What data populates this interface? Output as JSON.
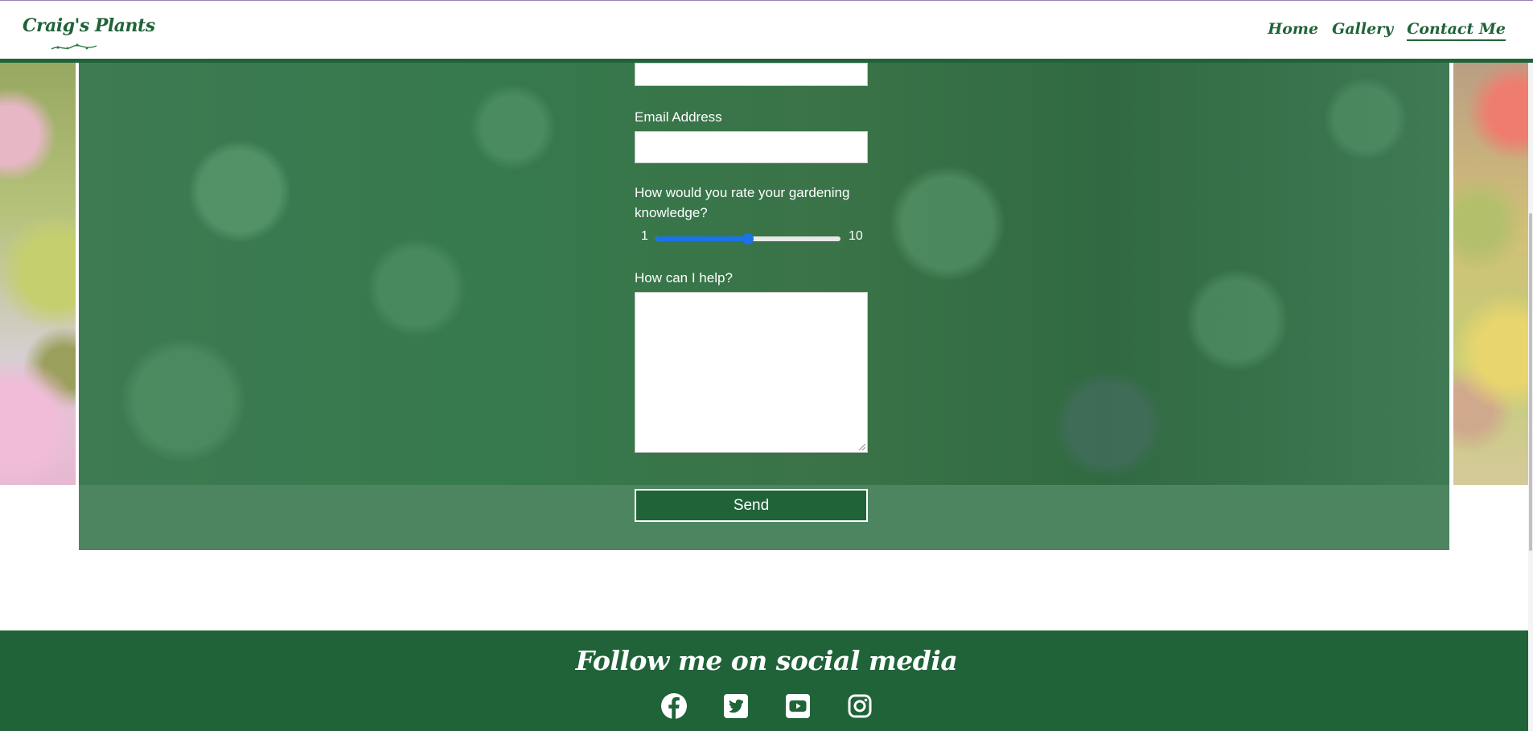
{
  "brand": {
    "name": "Craig's Plants"
  },
  "nav": {
    "items": [
      {
        "label": "Home",
        "active": false
      },
      {
        "label": "Gallery",
        "active": false
      },
      {
        "label": "Contact Me",
        "active": true
      }
    ]
  },
  "form": {
    "name_value": "",
    "email": {
      "label": "Email Address",
      "value": ""
    },
    "rating": {
      "label": "How would you rate your gardening knowledge?",
      "min": "1",
      "max": "10",
      "value": 5.5
    },
    "help": {
      "label": "How can I help?",
      "value": ""
    },
    "send_label": "Send"
  },
  "footer": {
    "title": "Follow me on social media",
    "icons": [
      "facebook-icon",
      "twitter-icon",
      "youtube-icon",
      "instagram-icon"
    ]
  },
  "colors": {
    "brand_green": "#206339",
    "band_green": "#4d8561",
    "slider_blue": "#1a73e8"
  }
}
